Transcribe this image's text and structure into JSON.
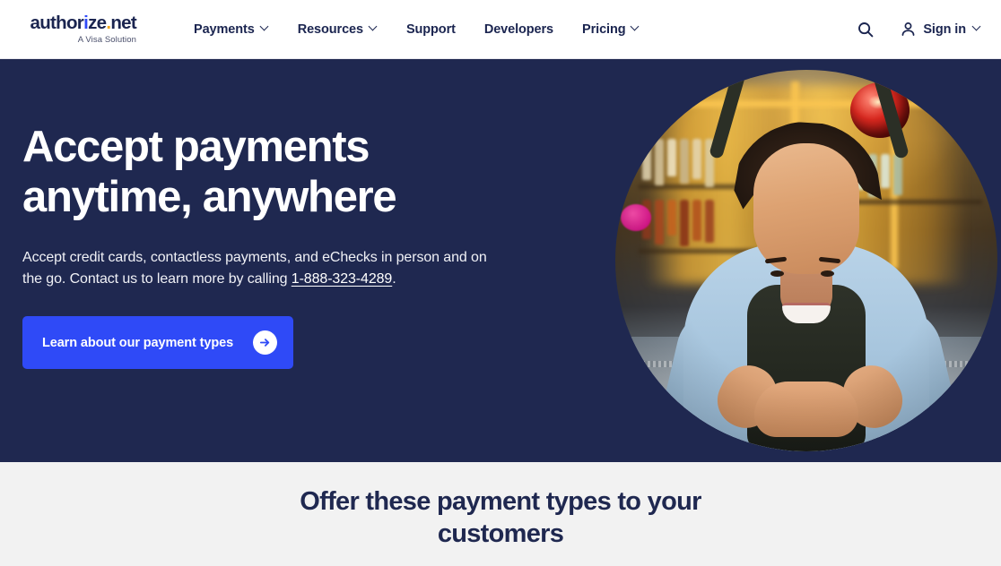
{
  "header": {
    "logo": {
      "word_a": "author",
      "word_i": "i",
      "word_b": "ze",
      "dot": ".",
      "word_net": "net",
      "full_text": "authorize.net",
      "tagline": "A Visa Solution"
    },
    "nav": [
      {
        "label": "Payments",
        "has_chevron": true
      },
      {
        "label": "Resources",
        "has_chevron": true
      },
      {
        "label": "Support",
        "has_chevron": false
      },
      {
        "label": "Developers",
        "has_chevron": false
      },
      {
        "label": "Pricing",
        "has_chevron": true
      }
    ],
    "search_icon": "search-icon",
    "signin": {
      "label": "Sign in",
      "icon": "user-icon",
      "has_chevron": true
    }
  },
  "hero": {
    "title": "Accept payments\nanytime, anywhere",
    "title_line1": "Accept payments",
    "title_line2": "anytime, anywhere",
    "body_before": "Accept credit cards, contactless payments, and eChecks in person and on the go. Contact us to learn more by calling ",
    "phone": "1-888-323-4289",
    "body_after": ".",
    "cta_label": "Learn about our payment types",
    "cta_icon": "arrow-right-circle-icon",
    "photo_alt": "Smiling shop owner leaning on a bar counter",
    "background_color": "#1F2850",
    "cta_color": "#2F4AF7"
  },
  "section": {
    "title": "Offer these payment types to your customers",
    "background_color": "#F2F2F2",
    "title_color": "#1F2850"
  }
}
